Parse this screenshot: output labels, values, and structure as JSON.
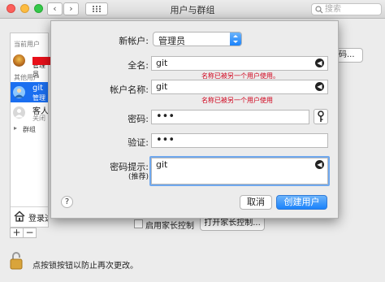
{
  "window": {
    "title": "用户与群组",
    "search_placeholder": "搜索",
    "back": "‹",
    "forward": "›"
  },
  "sidebar": {
    "current_users_header": "当前用户",
    "current_user_role": "管理员",
    "other_users_header": "其他用户",
    "user_git_name": "git",
    "user_git_role": "管理员",
    "guest_name": "客人",
    "guest_status": "关闭",
    "groups_label": "群组",
    "login_options_label": "登录选项",
    "add_label": "+",
    "remove_label": "−"
  },
  "background": {
    "password_btn_fragment": "码...",
    "parental_checkbox_label": "启用家长控制",
    "open_parental_button": "打开家长控制..."
  },
  "dialog": {
    "account_type_label": "新帐户:",
    "account_type_value": "管理员",
    "fullname_label": "全名:",
    "fullname_value": "git",
    "fullname_error": "名称已被另一个用户使用。",
    "account_name_label": "帐户名称:",
    "account_name_value": "git",
    "account_name_error": "名称已被另一个用户使用",
    "password_label": "密码:",
    "password_value": "•••",
    "verify_label": "验证:",
    "verify_value": "•••",
    "hint_label": "密码提示:",
    "hint_sublabel": "(推荐)",
    "hint_value": "git",
    "cancel_label": "取消",
    "create_label": "创建用户",
    "help_label": "?"
  },
  "lock": {
    "text": "点按锁按钮以防止再次更改。"
  }
}
